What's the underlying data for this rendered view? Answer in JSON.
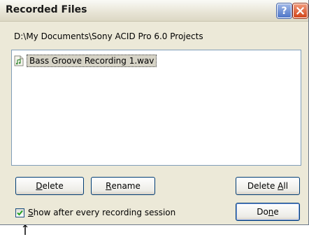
{
  "window": {
    "title": "Recorded Files"
  },
  "folder_path": "D:\\My Documents\\Sony ACID Pro 6.0 Projects",
  "files": [
    {
      "name": "Bass Groove Recording 1.wav",
      "selected": true,
      "icon": "audio-file-icon"
    }
  ],
  "buttons": {
    "delete": {
      "pre": "",
      "mnemonic": "D",
      "post": "elete"
    },
    "rename": {
      "pre": "",
      "mnemonic": "R",
      "post": "ename"
    },
    "delete_all": {
      "pre": "Delete ",
      "mnemonic": "A",
      "post": "ll"
    },
    "done": {
      "pre": "Do",
      "mnemonic": "n",
      "post": "e"
    }
  },
  "show_after_recording": {
    "checked": true,
    "pre": "",
    "mnemonic": "S",
    "post": "how after every recording session"
  },
  "colors": {
    "dialog_bg": "#ece9d8",
    "close_button": "#d2451a",
    "help_button": "#4f76c8",
    "selection": "#d6d3c6"
  }
}
